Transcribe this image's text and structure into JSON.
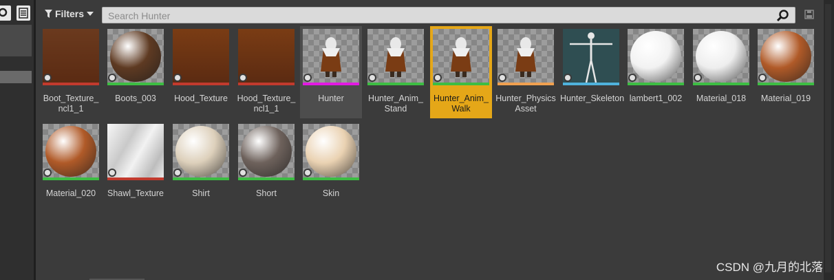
{
  "toolbar": {
    "filters_label": "Filters",
    "search_placeholder": "Search Hunter"
  },
  "assets": [
    {
      "label": "Boot_Texture_\nncl1_1",
      "kind": "texture",
      "bar_color": "#c23a2e",
      "thumb": "#6b3a1e"
    },
    {
      "label": "Boots_003",
      "kind": "material",
      "bar_color": "#3dbd43",
      "thumb": "#5e3a22"
    },
    {
      "label": "Hood_Texture",
      "kind": "texture",
      "bar_color": "#c23a2e",
      "thumb": "#7a3c14"
    },
    {
      "label": "Hood_Texture_\nncl1_1",
      "kind": "texture",
      "bar_color": "#c23a2e",
      "thumb": "#7a3c14"
    },
    {
      "label": "Hunter",
      "kind": "mesh",
      "bar_color": "#e219e2",
      "thumb": "#7a3c14",
      "state": "hover"
    },
    {
      "label": "Hunter_Anim_\nStand",
      "kind": "anim",
      "bar_color": "#3dbd43",
      "thumb": "#7a3c14"
    },
    {
      "label": "Hunter_Anim_\nWalk",
      "kind": "anim",
      "bar_color": "#3dbd43",
      "thumb": "#7a3c14",
      "state": "selected"
    },
    {
      "label": "Hunter_Physics\nAsset",
      "kind": "mesh",
      "bar_color": "#f0a050",
      "thumb": "#7a3c14"
    },
    {
      "label": "Hunter_Skeleton",
      "kind": "skeleton",
      "bar_color": "#4fb2dc",
      "thumb": "#2f4e52"
    },
    {
      "label": "lambert1_002",
      "kind": "material",
      "bar_color": "#3dbd43",
      "thumb": "#f2f2f2"
    },
    {
      "label": "Material_018",
      "kind": "material",
      "bar_color": "#3dbd43",
      "thumb": "#eeeeee"
    },
    {
      "label": "Material_019",
      "kind": "material",
      "bar_color": "#3dbd43",
      "thumb": "#b05a28"
    },
    {
      "label": "Material_020",
      "kind": "material",
      "bar_color": "#3dbd43",
      "thumb": "#b05a28"
    },
    {
      "label": "Shawl_Texture",
      "kind": "shawl",
      "bar_color": "#c23a2e",
      "thumb": "#e0e0e0"
    },
    {
      "label": "Shirt",
      "kind": "material",
      "bar_color": "#3dbd43",
      "thumb": "#ddd0bb"
    },
    {
      "label": "Short",
      "kind": "material",
      "bar_color": "#3dbd43",
      "thumb": "#6e625c"
    },
    {
      "label": "Skin",
      "kind": "material",
      "bar_color": "#3dbd43",
      "thumb": "#ead2b2"
    }
  ],
  "watermark": "CSDN @九月的北落"
}
